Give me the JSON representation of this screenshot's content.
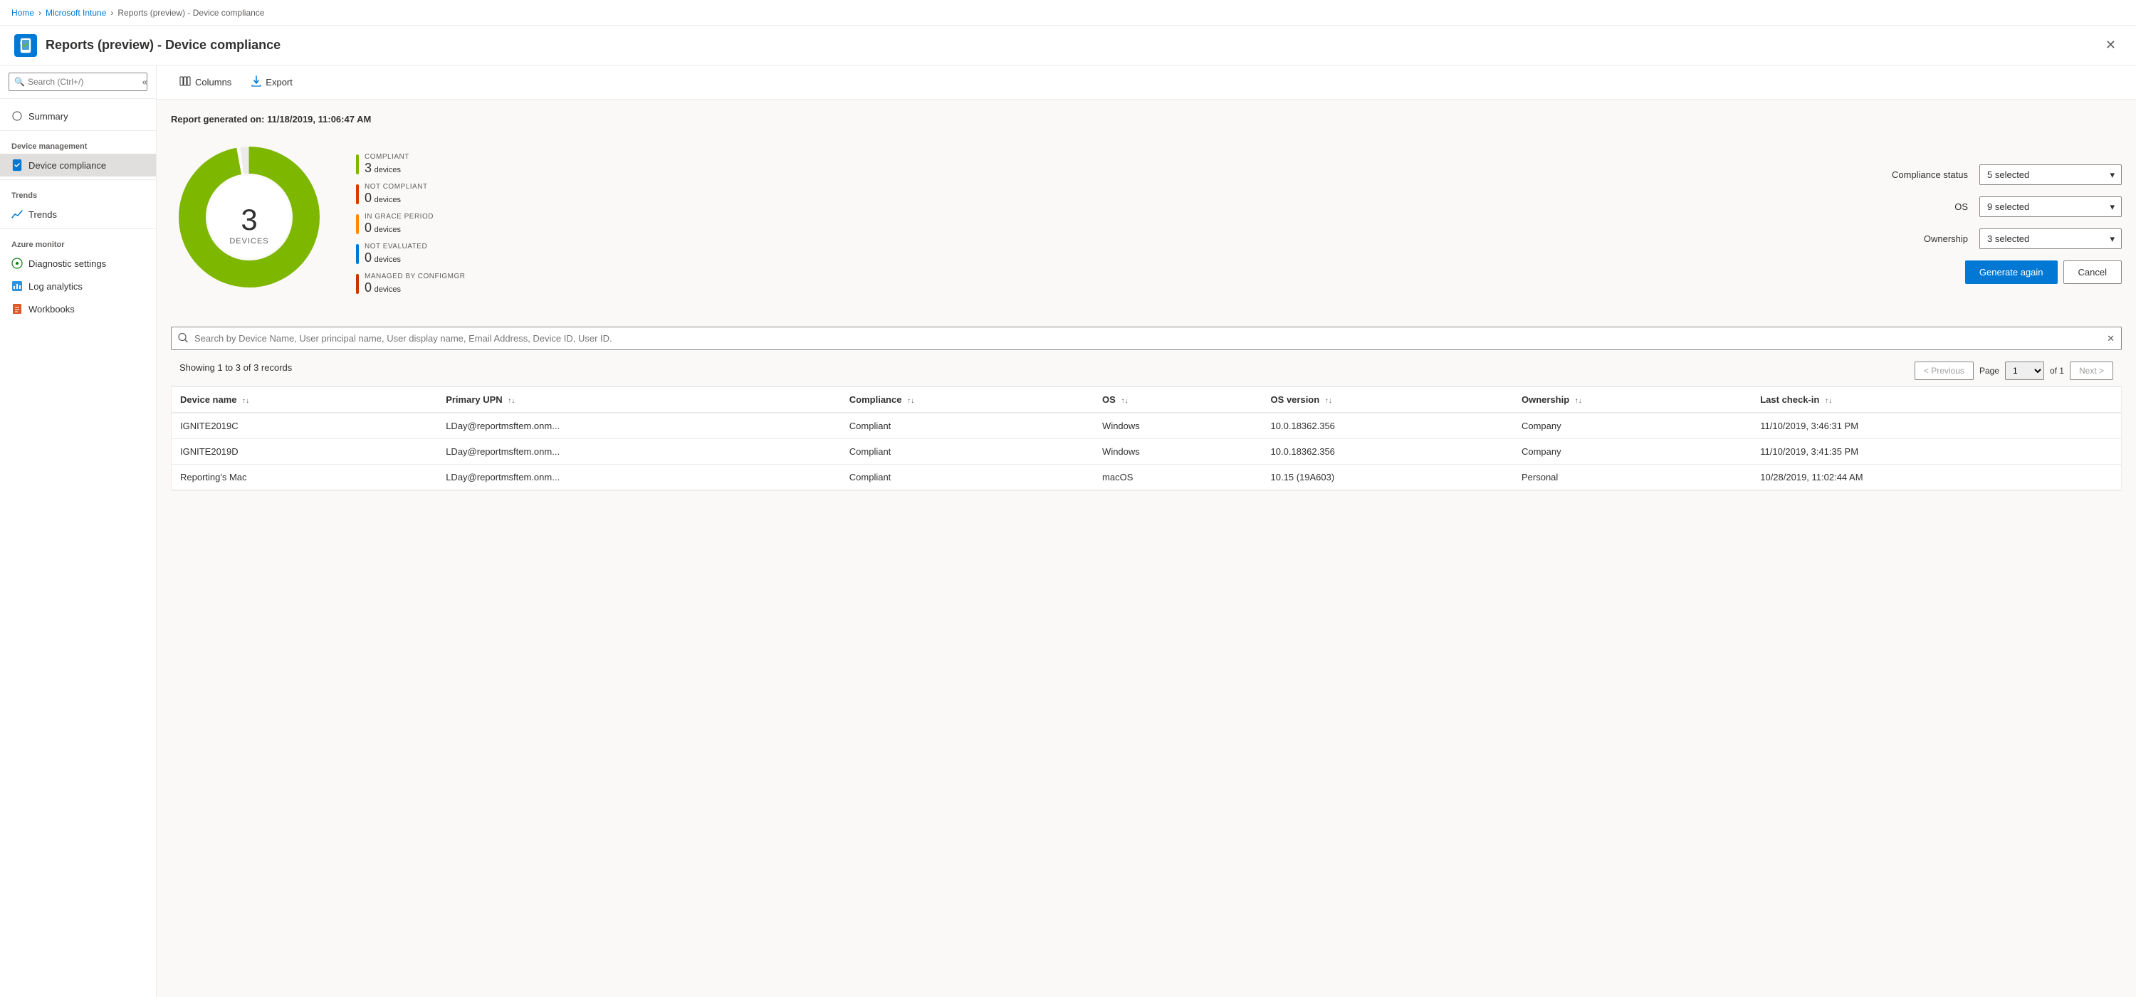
{
  "breadcrumb": {
    "items": [
      {
        "label": "Home",
        "link": true
      },
      {
        "label": "Microsoft Intune",
        "link": true
      },
      {
        "label": "Reports (preview) - Device compliance",
        "link": false
      }
    ]
  },
  "header": {
    "icon": "📱",
    "title": "Reports (preview) - Device compliance"
  },
  "toolbar": {
    "columns_label": "Columns",
    "export_label": "Export"
  },
  "report": {
    "generated_label": "Report generated on: 11/18/2019, 11:06:47 AM"
  },
  "donut": {
    "total": "3",
    "center_label": "DEVICES"
  },
  "legend": [
    {
      "category": "COMPLIANT",
      "count": "3",
      "unit": "devices",
      "color": "#7db700"
    },
    {
      "category": "NOT COMPLIANT",
      "count": "0",
      "unit": "devices",
      "color": "#d83b01"
    },
    {
      "category": "IN GRACE PERIOD",
      "count": "0",
      "unit": "devices",
      "color": "#ff8c00"
    },
    {
      "category": "NOT EVALUATED",
      "count": "0",
      "unit": "devices",
      "color": "#0078d4"
    },
    {
      "category": "MANAGED BY CONFIGMGR",
      "count": "0",
      "unit": "devices",
      "color": "#c43501"
    }
  ],
  "filters": {
    "compliance_status_label": "Compliance status",
    "compliance_status_value": "5 selected",
    "os_label": "OS",
    "os_value": "9 selected",
    "ownership_label": "Ownership",
    "ownership_value": "3 selected",
    "generate_label": "Generate again",
    "cancel_label": "Cancel"
  },
  "search": {
    "placeholder": "Search by Device Name, User principal name, User display name, Email Address, Device ID, User ID."
  },
  "table_meta": {
    "showing": "Showing 1 to 3 of 3 records",
    "page_label": "Page",
    "page_value": "1",
    "page_of": "of 1",
    "prev_label": "< Previous",
    "next_label": "Next >"
  },
  "table": {
    "columns": [
      {
        "label": "Device name",
        "key": "device_name"
      },
      {
        "label": "Primary UPN",
        "key": "primary_upn"
      },
      {
        "label": "Compliance",
        "key": "compliance"
      },
      {
        "label": "OS",
        "key": "os"
      },
      {
        "label": "OS version",
        "key": "os_version"
      },
      {
        "label": "Ownership",
        "key": "ownership"
      },
      {
        "label": "Last check-in",
        "key": "last_checkin"
      }
    ],
    "rows": [
      {
        "device_name": "IGNITE2019C",
        "primary_upn": "LDay@reportmsftem.onm...",
        "compliance": "Compliant",
        "os": "Windows",
        "os_version": "10.0.18362.356",
        "ownership": "Company",
        "last_checkin": "11/10/2019, 3:46:31 PM"
      },
      {
        "device_name": "IGNITE2019D",
        "primary_upn": "LDay@reportmsftem.onm...",
        "compliance": "Compliant",
        "os": "Windows",
        "os_version": "10.0.18362.356",
        "ownership": "Company",
        "last_checkin": "11/10/2019, 3:41:35 PM"
      },
      {
        "device_name": "Reporting's Mac",
        "primary_upn": "LDay@reportmsftem.onm...",
        "compliance": "Compliant",
        "os": "macOS",
        "os_version": "10.15 (19A603)",
        "ownership": "Personal",
        "last_checkin": "10/28/2019, 11:02:44 AM"
      }
    ]
  },
  "sidebar": {
    "search_placeholder": "Search (Ctrl+/)",
    "sections": [
      {
        "items": [
          {
            "label": "Summary",
            "icon": "○",
            "active": false,
            "id": "summary"
          }
        ]
      },
      {
        "section_label": "Device management",
        "items": [
          {
            "label": "Device compliance",
            "icon": "📋",
            "active": true,
            "id": "device-compliance"
          }
        ]
      },
      {
        "section_label": "Trends",
        "items": [
          {
            "label": "Trends",
            "icon": "📈",
            "active": false,
            "id": "trends"
          }
        ]
      },
      {
        "section_label": "Azure monitor",
        "items": [
          {
            "label": "Diagnostic settings",
            "icon": "⚙",
            "active": false,
            "id": "diagnostic-settings"
          },
          {
            "label": "Log analytics",
            "icon": "📊",
            "active": false,
            "id": "log-analytics"
          },
          {
            "label": "Workbooks",
            "icon": "📒",
            "active": false,
            "id": "workbooks"
          }
        ]
      }
    ]
  }
}
